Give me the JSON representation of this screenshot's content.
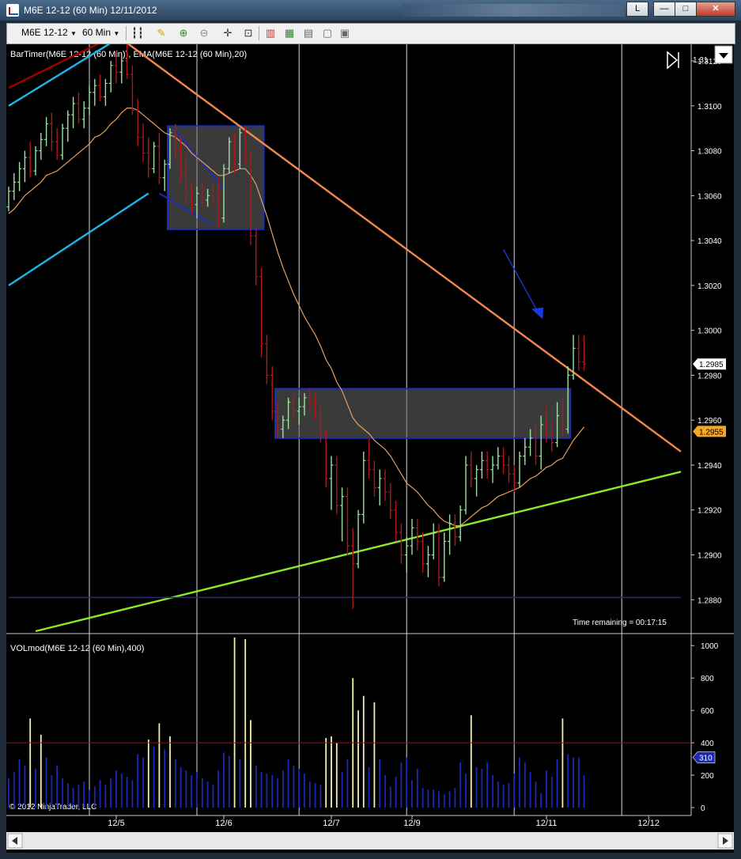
{
  "window": {
    "title": "M6E 12-12 (60 Min)  12/11/2012",
    "btn_l": "L",
    "btn_min": "—",
    "btn_max": "□",
    "btn_close": "✕"
  },
  "toolbar": {
    "instrument": "M6E 12-12",
    "interval": "60 Min"
  },
  "chart_data": {
    "type": "ohlc",
    "indicator_label": "BarTimer(M6E 12-12 (60 Min)), EMA(M6E 12-12 (60 Min),20)",
    "volume_label": "VOLmod(M6E 12-12 (60 Min),400)",
    "copyright": "© 2012 NinjaTrader, LLC",
    "time_remaining": "Time remaining = 00:17:15",
    "price_axis": {
      "min": 1.2866,
      "max": 1.3126,
      "ticks": [
        "1.3120",
        "1.3100",
        "1.3080",
        "1.3060",
        "1.3040",
        "1.3020",
        "1.3000",
        "1.2980",
        "1.2960",
        "1.2940",
        "1.2920",
        "1.2900",
        "1.2880"
      ],
      "top_tick": "1.31"
    },
    "price_badges": [
      {
        "label": "1.2985",
        "value": 1.2985,
        "color": "#ffffff"
      },
      {
        "label": "1.2955",
        "value": 1.2955,
        "color": "#f5a623"
      }
    ],
    "volume_axis": {
      "min": 0,
      "max": 1050,
      "ticks": [
        "1000",
        "800",
        "600",
        "400",
        "200",
        "0"
      ]
    },
    "volume_badge": {
      "label": "310",
      "value": 310
    },
    "volume_reference_line": 400,
    "x_labels": [
      {
        "label": "12/5",
        "bar": 20
      },
      {
        "label": "12/6",
        "bar": 40
      },
      {
        "label": "12/7",
        "bar": 60
      },
      {
        "label": "12/9",
        "bar": 75
      },
      {
        "label": "12/11",
        "bar": 100
      },
      {
        "label": "12/12",
        "bar": 119
      }
    ],
    "session_lines": [
      15,
      35,
      54,
      74,
      94,
      114
    ],
    "ohlc": [
      [
        1.3055,
        1.3064,
        1.3053,
        1.3062
      ],
      [
        1.3062,
        1.307,
        1.3058,
        1.3066
      ],
      [
        1.3066,
        1.3075,
        1.3062,
        1.3072
      ],
      [
        1.3072,
        1.308,
        1.3066,
        1.3077
      ],
      [
        1.3077,
        1.3084,
        1.3068,
        1.3071
      ],
      [
        1.3071,
        1.3082,
        1.3069,
        1.308
      ],
      [
        1.308,
        1.3088,
        1.3076,
        1.3085
      ],
      [
        1.3085,
        1.3095,
        1.3082,
        1.3092
      ],
      [
        1.3092,
        1.3097,
        1.308,
        1.3084
      ],
      [
        1.3084,
        1.309,
        1.3076,
        1.3078
      ],
      [
        1.3078,
        1.3092,
        1.3076,
        1.309
      ],
      [
        1.309,
        1.3098,
        1.3084,
        1.3096
      ],
      [
        1.3096,
        1.3104,
        1.309,
        1.3101
      ],
      [
        1.3101,
        1.3106,
        1.3092,
        1.3094
      ],
      [
        1.3094,
        1.3102,
        1.309,
        1.3099
      ],
      [
        1.3099,
        1.3109,
        1.3096,
        1.3106
      ],
      [
        1.3106,
        1.3112,
        1.31,
        1.3109
      ],
      [
        1.3109,
        1.3114,
        1.3102,
        1.3104
      ],
      [
        1.3104,
        1.3112,
        1.31,
        1.311
      ],
      [
        1.311,
        1.312,
        1.3106,
        1.3118
      ],
      [
        1.3118,
        1.3124,
        1.311,
        1.3115
      ],
      [
        1.3115,
        1.3122,
        1.311,
        1.312
      ],
      [
        1.312,
        1.3128,
        1.3112,
        1.3114
      ],
      [
        1.3114,
        1.3118,
        1.3096,
        1.3098
      ],
      [
        1.3098,
        1.3103,
        1.3082,
        1.3086
      ],
      [
        1.3086,
        1.3092,
        1.3075,
        1.3079
      ],
      [
        1.3079,
        1.3086,
        1.3068,
        1.3072
      ],
      [
        1.3072,
        1.3084,
        1.307,
        1.3082
      ],
      [
        1.3082,
        1.3088,
        1.3065,
        1.3068
      ],
      [
        1.3068,
        1.3076,
        1.3062,
        1.3074
      ],
      [
        1.3074,
        1.309,
        1.3072,
        1.3088
      ],
      [
        1.3088,
        1.3092,
        1.3076,
        1.308
      ],
      [
        1.308,
        1.3086,
        1.3066,
        1.307
      ],
      [
        1.307,
        1.3078,
        1.3056,
        1.306
      ],
      [
        1.306,
        1.3066,
        1.3052,
        1.3056
      ],
      [
        1.3056,
        1.3064,
        1.305,
        1.3061
      ],
      [
        1.3061,
        1.3066,
        1.3055,
        1.3058
      ],
      [
        1.3058,
        1.3063,
        1.3055,
        1.306
      ],
      [
        1.306,
        1.3066,
        1.3056,
        1.3058
      ],
      [
        1.3058,
        1.3068,
        1.3046,
        1.305
      ],
      [
        1.305,
        1.3074,
        1.3048,
        1.3072
      ],
      [
        1.3072,
        1.3086,
        1.307,
        1.3084
      ],
      [
        1.3084,
        1.3088,
        1.307,
        1.3074
      ],
      [
        1.3074,
        1.309,
        1.3072,
        1.3088
      ],
      [
        1.3088,
        1.3091,
        1.3074,
        1.3076
      ],
      [
        1.3076,
        1.308,
        1.3038,
        1.3042
      ],
      [
        1.3042,
        1.3046,
        1.302,
        1.3024
      ],
      [
        1.3024,
        1.3028,
        1.2988,
        1.2994
      ],
      [
        1.2994,
        1.2998,
        1.2976,
        1.298
      ],
      [
        1.298,
        1.2984,
        1.296,
        1.2964
      ],
      [
        1.2964,
        1.2968,
        1.2952,
        1.2956
      ],
      [
        1.2956,
        1.2962,
        1.2952,
        1.296
      ],
      [
        1.296,
        1.297,
        1.2956,
        1.2968
      ],
      [
        1.2968,
        1.2972,
        1.296,
        1.2964
      ],
      [
        1.2964,
        1.297,
        1.2958,
        1.2966
      ],
      [
        1.2966,
        1.2972,
        1.2962,
        1.297
      ],
      [
        1.297,
        1.2974,
        1.2964,
        1.2968
      ],
      [
        1.2968,
        1.2972,
        1.296,
        1.2962
      ],
      [
        1.2962,
        1.2966,
        1.295,
        1.2954
      ],
      [
        1.2954,
        1.2956,
        1.293,
        1.2934
      ],
      [
        1.2934,
        1.2944,
        1.292,
        1.294
      ],
      [
        1.294,
        1.2944,
        1.2918,
        1.2922
      ],
      [
        1.2922,
        1.293,
        1.2906,
        1.2926
      ],
      [
        1.2926,
        1.293,
        1.29,
        1.2904
      ],
      [
        1.2904,
        1.2912,
        1.2876,
        1.2896
      ],
      [
        1.2896,
        1.292,
        1.2894,
        1.2918
      ],
      [
        1.2918,
        1.2946,
        1.2914,
        1.2942
      ],
      [
        1.2942,
        1.2952,
        1.2934,
        1.2938
      ],
      [
        1.2938,
        1.2942,
        1.2926,
        1.293
      ],
      [
        1.293,
        1.2938,
        1.2922,
        1.2934
      ],
      [
        1.2934,
        1.2938,
        1.2924,
        1.2928
      ],
      [
        1.2928,
        1.2932,
        1.2916,
        1.292
      ],
      [
        1.292,
        1.2924,
        1.2906,
        1.291
      ],
      [
        1.291,
        1.2914,
        1.2896,
        1.29
      ],
      [
        1.29,
        1.2908,
        1.2892,
        1.2904
      ],
      [
        1.2904,
        1.2916,
        1.29,
        1.2912
      ],
      [
        1.2912,
        1.2916,
        1.2902,
        1.2906
      ],
      [
        1.2906,
        1.291,
        1.2892,
        1.2896
      ],
      [
        1.2896,
        1.2904,
        1.289,
        1.29
      ],
      [
        1.29,
        1.2914,
        1.2898,
        1.291
      ],
      [
        1.291,
        1.2914,
        1.2886,
        1.289
      ],
      [
        1.289,
        1.291,
        1.2888,
        1.2906
      ],
      [
        1.2906,
        1.2918,
        1.29,
        1.2914
      ],
      [
        1.2914,
        1.2918,
        1.2904,
        1.2908
      ],
      [
        1.2908,
        1.2922,
        1.2906,
        1.292
      ],
      [
        1.292,
        1.2944,
        1.2918,
        1.294
      ],
      [
        1.294,
        1.2946,
        1.293,
        1.2934
      ],
      [
        1.2934,
        1.294,
        1.2926,
        1.2938
      ],
      [
        1.2938,
        1.2946,
        1.2934,
        1.2942
      ],
      [
        1.2942,
        1.2946,
        1.2934,
        1.2938
      ],
      [
        1.2938,
        1.2944,
        1.2932,
        1.294
      ],
      [
        1.294,
        1.2948,
        1.2938,
        1.2944
      ],
      [
        1.2944,
        1.2948,
        1.2936,
        1.294
      ],
      [
        1.294,
        1.2944,
        1.2932,
        1.2936
      ],
      [
        1.2936,
        1.294,
        1.2928,
        1.2932
      ],
      [
        1.2932,
        1.2946,
        1.293,
        1.2944
      ],
      [
        1.2944,
        1.2952,
        1.294,
        1.2948
      ],
      [
        1.2948,
        1.2956,
        1.2944,
        1.2952
      ],
      [
        1.2952,
        1.2958,
        1.294,
        1.2944
      ],
      [
        1.2944,
        1.2962,
        1.2938,
        1.2958
      ],
      [
        1.2958,
        1.2966,
        1.295,
        1.2954
      ],
      [
        1.2954,
        1.296,
        1.2946,
        1.295
      ],
      [
        1.295,
        1.2968,
        1.2948,
        1.2962
      ],
      [
        1.2962,
        1.297,
        1.2952,
        1.2956
      ],
      [
        1.2956,
        1.2984,
        1.2954,
        1.298
      ],
      [
        1.298,
        1.2998,
        1.2978,
        1.2992
      ],
      [
        1.2992,
        1.2998,
        1.2982,
        1.2986
      ],
      [
        1.2986,
        1.2998,
        1.2982,
        1.2985
      ]
    ],
    "ema20": [
      1.3052,
      1.3054,
      1.3057,
      1.306,
      1.3062,
      1.3064,
      1.3066,
      1.3069,
      1.307,
      1.3071,
      1.3073,
      1.3075,
      1.3077,
      1.3079,
      1.3081,
      1.3083,
      1.3086,
      1.3087,
      1.3089,
      1.3092,
      1.3094,
      1.3097,
      1.3099,
      1.3099,
      1.3098,
      1.3096,
      1.3094,
      1.3092,
      1.309,
      1.3088,
      1.3087,
      1.3086,
      1.3084,
      1.3082,
      1.3079,
      1.3077,
      1.3075,
      1.3073,
      1.3071,
      1.3069,
      1.3069,
      1.307,
      1.3071,
      1.3072,
      1.3072,
      1.3069,
      1.3065,
      1.3058,
      1.3051,
      1.3043,
      1.3035,
      1.3028,
      1.3022,
      1.3016,
      1.3011,
      1.3006,
      1.3002,
      1.2998,
      1.2993,
      1.2987,
      1.2983,
      1.2977,
      1.2973,
      1.2967,
      1.2961,
      1.2958,
      1.2956,
      1.2954,
      1.2951,
      1.2949,
      1.2947,
      1.2944,
      1.294,
      1.2936,
      1.2932,
      1.293,
      1.2928,
      1.2925,
      1.2922,
      1.292,
      1.2917,
      1.2915,
      1.2914,
      1.2913,
      1.2913,
      1.2915,
      1.2917,
      1.2919,
      1.2921,
      1.2922,
      1.2924,
      1.2926,
      1.2927,
      1.2928,
      1.2929,
      1.293,
      1.2932,
      1.2934,
      1.2935,
      1.2937,
      1.2939,
      1.294,
      1.2942,
      1.2943,
      1.2947,
      1.2951,
      1.2954,
      1.2957
    ],
    "volume": [
      180,
      220,
      300,
      260,
      550,
      240,
      450,
      310,
      200,
      260,
      180,
      150,
      120,
      140,
      160,
      110,
      130,
      170,
      140,
      180,
      230,
      210,
      190,
      170,
      330,
      310,
      420,
      380,
      520,
      360,
      440,
      300,
      250,
      230,
      200,
      220,
      180,
      160,
      140,
      230,
      340,
      320,
      1050,
      300,
      1040,
      540,
      260,
      220,
      210,
      200,
      180,
      230,
      300,
      260,
      240,
      210,
      160,
      150,
      140,
      430,
      440,
      400,
      220,
      300,
      800,
      600,
      690,
      250,
      650,
      300,
      200,
      130,
      190,
      280,
      310,
      170,
      240,
      120,
      110,
      110,
      100,
      80,
      100,
      120,
      280,
      210,
      570,
      250,
      240,
      280,
      200,
      160,
      140,
      150,
      210,
      310,
      280,
      220,
      160,
      90,
      230,
      190,
      300,
      550,
      330,
      310,
      310,
      200
    ],
    "trend_lines": [
      {
        "name": "orange-trendline",
        "color": "#f4894f",
        "from": [
          22,
          1.3128
        ],
        "to": [
          125,
          1.2946
        ]
      },
      {
        "name": "green-trendline",
        "color": "#8ee82a",
        "from": [
          5,
          1.2866
        ],
        "to": [
          125,
          1.2937
        ]
      },
      {
        "name": "darkred-trendline",
        "color": "#a00000",
        "from": [
          0,
          1.3108
        ],
        "to": [
          22,
          1.3134
        ]
      },
      {
        "name": "cyan-channel-upper",
        "color": "#1ab7ea",
        "from": [
          0,
          1.31
        ],
        "to": [
          19,
          1.3128
        ]
      },
      {
        "name": "cyan-channel-lower",
        "color": "#1ab7ea",
        "from": [
          0,
          1.302
        ],
        "to": [
          26,
          1.3061
        ]
      },
      {
        "name": "navy-horizontal",
        "color": "#1c2d9a",
        "from": [
          0,
          1.2881
        ],
        "to": [
          125,
          1.2881
        ]
      }
    ],
    "rectangles": [
      {
        "name": "consolidation-box-upper",
        "bars": [
          30,
          47
        ],
        "prices": [
          1.3045,
          1.3091
        ]
      },
      {
        "name": "consolidation-box-lower",
        "bars": [
          50,
          104
        ],
        "prices": [
          1.2952,
          1.2974
        ]
      }
    ],
    "arrow": {
      "from": [
        92,
        1.3036
      ],
      "to": [
        99,
        1.3006
      ],
      "color": "#1a3ae0"
    }
  }
}
